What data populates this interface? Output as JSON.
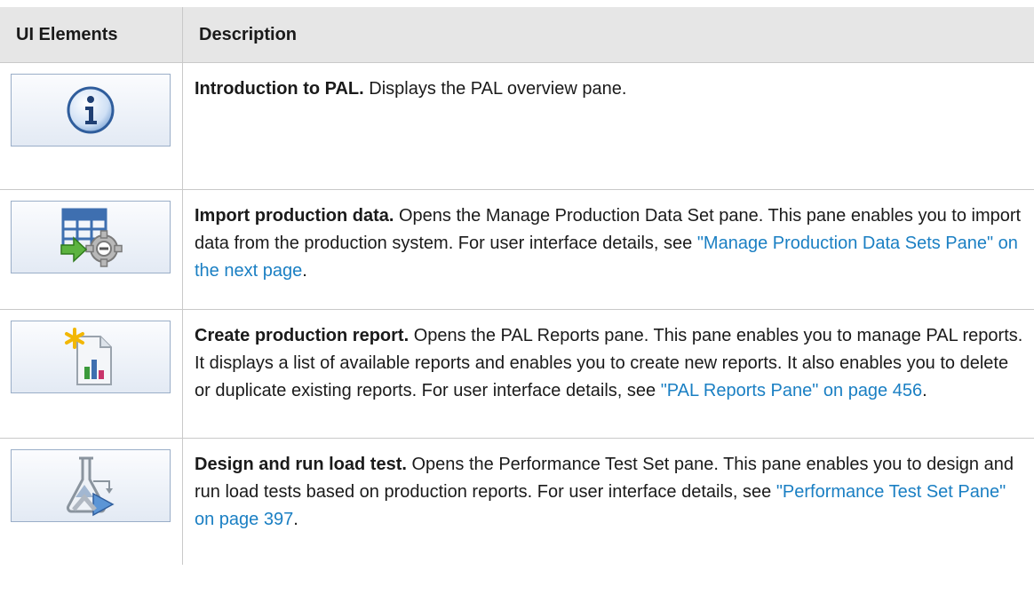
{
  "header": {
    "col_ui_elements": "UI Elements",
    "col_description": "Description"
  },
  "rows": [
    {
      "icon": "info-icon",
      "term": "Introduction to PAL.",
      "text": " Displays the PAL overview pane.",
      "link": "",
      "text_after": ""
    },
    {
      "icon": "import-data-icon",
      "term": "Import production data.",
      "text": " Opens the Manage Production Data Set pane. This pane enables you to import data from the production system. For user interface details, see ",
      "link": "\"Manage Production Data Sets Pane\" on the next page",
      "text_after": "."
    },
    {
      "icon": "create-report-icon",
      "term": "Create production report.",
      "text": " Opens the PAL Reports pane. This pane enables you to manage PAL reports. It displays a list of available reports and enables you to create new reports. It also enables you to delete or duplicate existing reports. For user interface details, see ",
      "link": "\"PAL Reports Pane\" on page 456",
      "text_after": "."
    },
    {
      "icon": "load-test-icon",
      "term": "Design and run load test.",
      "text": " Opens the Performance Test Set pane. This pane enables you to design and run load tests based on production reports. For user interface details, see ",
      "link": "\"Performance Test Set Pane\" on page 397",
      "text_after": "."
    }
  ],
  "colors": {
    "header_bg": "#e6e6e6",
    "link": "#1a7fc3",
    "border": "#c9c9c9"
  }
}
